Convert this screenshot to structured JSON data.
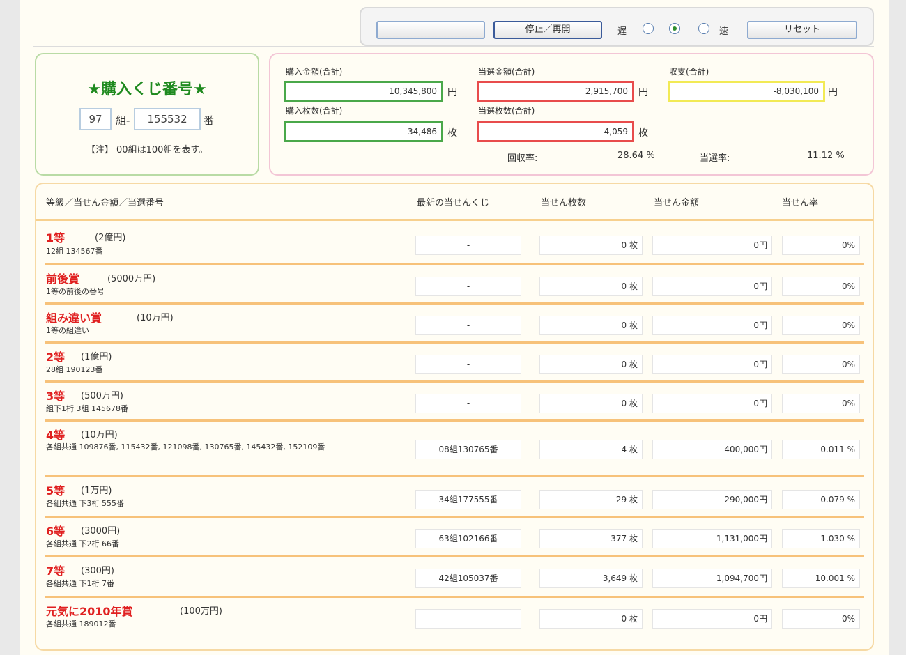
{
  "controls": {
    "start_label": "",
    "pause_label": "停止／再開",
    "speed_slow": "遅",
    "speed_fast": "速",
    "reset_label": "リセット",
    "speed_selected": "medium"
  },
  "number_box": {
    "title": "★購入くじ番号★",
    "group": "97",
    "group_unit": "組-",
    "number": "155532",
    "number_unit": "番",
    "note": "【注】 00組は100組を表す。"
  },
  "summary": {
    "purchase_amount_label": "購入金額(合計)",
    "purchase_amount": "10,345,800",
    "winning_amount_label": "当選金額(合計)",
    "winning_amount": "2,915,700",
    "balance_label": "収支(合計)",
    "balance": "-8,030,100",
    "yen": "円",
    "purchase_count_label": "購入枚数(合計)",
    "purchase_count": "34,486",
    "winning_count_label": "当選枚数(合計)",
    "winning_count": "4,059",
    "sheet": "枚",
    "recovery_label": "回収率:",
    "recovery_value": "28.64 %",
    "win_rate_label": "当選率:",
    "win_rate_value": "11.12 %"
  },
  "table": {
    "headers": [
      "等級／当せん金額／当選番号",
      "最新の当せんくじ",
      "当せん枚数",
      "当せん金額",
      "当せん率"
    ],
    "rows": [
      {
        "name": "1等",
        "amount": "(2億円)",
        "desc": "12組 134567番",
        "latest": "-",
        "count": "0 枚",
        "money": "0円",
        "rate": "0%"
      },
      {
        "name": "前後賞",
        "amount": "(5000万円)",
        "desc": "1等の前後の番号",
        "latest": "-",
        "count": "0 枚",
        "money": "0円",
        "rate": "0%"
      },
      {
        "name": "組み違い賞",
        "amount": "(10万円)",
        "desc": "1等の組違い",
        "latest": "-",
        "count": "0 枚",
        "money": "0円",
        "rate": "0%"
      },
      {
        "name": "2等",
        "amount": "(1億円)",
        "desc": "28組 190123番",
        "latest": "-",
        "count": "0 枚",
        "money": "0円",
        "rate": "0%"
      },
      {
        "name": "3等",
        "amount": "(500万円)",
        "desc": "組下1桁 3組 145678番",
        "latest": "-",
        "count": "0 枚",
        "money": "0円",
        "rate": "0%"
      },
      {
        "name": "4等",
        "amount": "(10万円)",
        "desc": "各組共通 109876番, 115432番, 121098番, 130765番, 145432番, 152109番",
        "latest": "08組130765番",
        "count": "4 枚",
        "money": "400,000円",
        "rate": "0.011 %"
      },
      {
        "name": "5等",
        "amount": "(1万円)",
        "desc": "各組共通 下3桁 555番",
        "latest": "34組177555番",
        "count": "29 枚",
        "money": "290,000円",
        "rate": "0.079 %"
      },
      {
        "name": "6等",
        "amount": "(3000円)",
        "desc": "各組共通 下2桁 66番",
        "latest": "63組102166番",
        "count": "377 枚",
        "money": "1,131,000円",
        "rate": "1.030 %"
      },
      {
        "name": "7等",
        "amount": "(300円)",
        "desc": "各組共通 下1桁 7番",
        "latest": "42組105037番",
        "count": "3,649 枚",
        "money": "1,094,700円",
        "rate": "10.001 %"
      },
      {
        "name": "元気に2010年賞",
        "amount": "(100万円)",
        "desc": "各組共通 189012番",
        "latest": "-",
        "count": "0 枚",
        "money": "0円",
        "rate": "0%"
      }
    ]
  }
}
